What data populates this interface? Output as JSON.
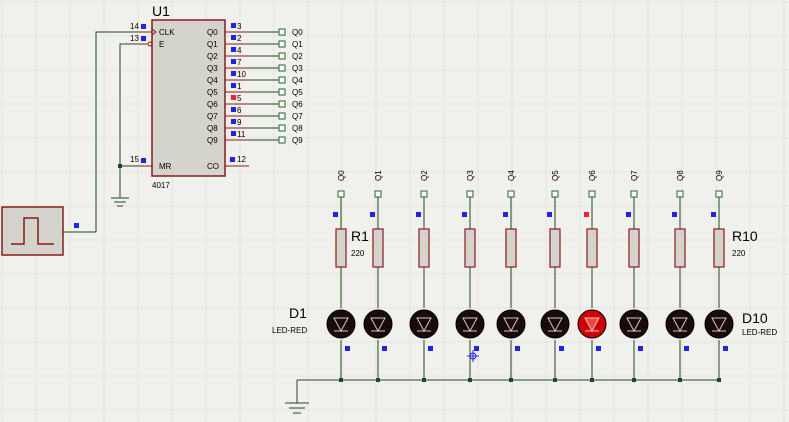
{
  "chip": {
    "ref": "U1",
    "part": "4017",
    "left_pins": [
      {
        "num": "14",
        "name": "CLK"
      },
      {
        "num": "13",
        "name": "E"
      },
      {
        "num": "15",
        "name": "MR"
      }
    ],
    "right_pins": [
      {
        "num": "3",
        "name": "Q0",
        "net": "Q0",
        "active": false
      },
      {
        "num": "2",
        "name": "Q1",
        "net": "Q1",
        "active": false
      },
      {
        "num": "4",
        "name": "Q2",
        "net": "Q2",
        "active": false
      },
      {
        "num": "7",
        "name": "Q3",
        "net": "Q3",
        "active": false
      },
      {
        "num": "10",
        "name": "Q4",
        "net": "Q4",
        "active": false
      },
      {
        "num": "1",
        "name": "Q5",
        "net": "Q5",
        "active": false
      },
      {
        "num": "5",
        "name": "Q6",
        "net": "Q6",
        "active": true
      },
      {
        "num": "6",
        "name": "Q7",
        "net": "Q7",
        "active": false
      },
      {
        "num": "9",
        "name": "Q8",
        "net": "Q8",
        "active": false
      },
      {
        "num": "11",
        "name": "Q9",
        "net": "Q9",
        "active": false
      }
    ],
    "co_pin": {
      "num": "12",
      "name": "CO"
    }
  },
  "columns": [
    {
      "net": "Q0",
      "active": false
    },
    {
      "net": "Q1",
      "active": false
    },
    {
      "net": "Q2",
      "active": false
    },
    {
      "net": "Q3",
      "active": false
    },
    {
      "net": "Q4",
      "active": false
    },
    {
      "net": "Q5",
      "active": false
    },
    {
      "net": "Q6",
      "active": true
    },
    {
      "net": "Q7",
      "active": false
    },
    {
      "net": "Q8",
      "active": false
    },
    {
      "net": "Q9",
      "active": false
    }
  ],
  "resistor_first": {
    "ref": "R1",
    "value": "220"
  },
  "resistor_last": {
    "ref": "R10",
    "value": "220"
  },
  "led_first": {
    "ref": "D1",
    "value": "LED-RED"
  },
  "led_last": {
    "ref": "D10",
    "value": "LED-RED"
  },
  "colors": {
    "background": "#f0f0ec",
    "grid": "#dcdcd6",
    "wire": "#1f4a1f",
    "component": "#8b1a1a",
    "component_fill": "#d4d4cc",
    "pin_low": "#2020ff",
    "pin_high": "#ff2020",
    "led_off": "#1a0a0a",
    "led_on": "#d40000"
  }
}
